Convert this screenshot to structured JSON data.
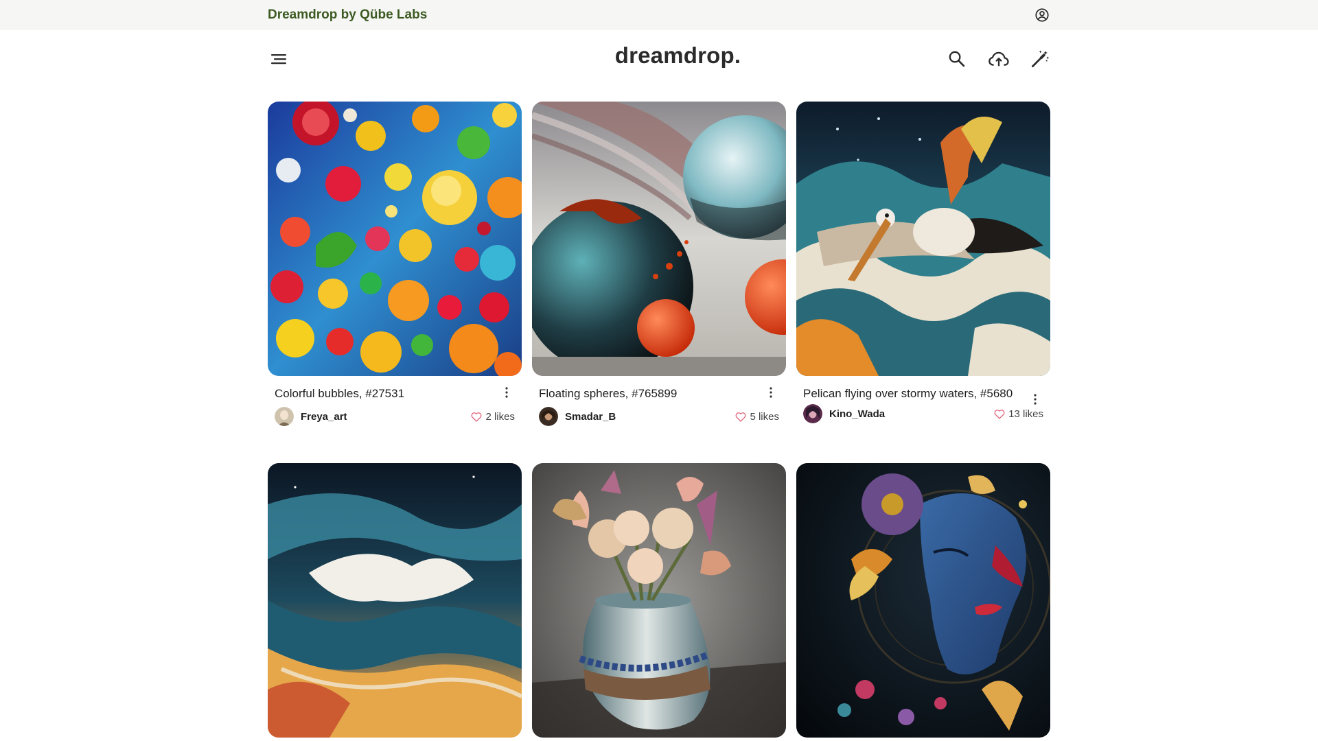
{
  "brandbar": {
    "title": "Dreamdrop by Qübe Labs",
    "account_icon": "account-circle-icon"
  },
  "header": {
    "logo": "dreamdrop.",
    "menu_icon": "menu-icon",
    "search_icon": "search-icon",
    "upload_icon": "cloud-upload-icon",
    "create_icon": "magic-wand-icon"
  },
  "colors": {
    "brand_text": "#3c5a21",
    "brandbar_bg": "#f6f6f5",
    "heart": "#e0637a"
  },
  "cards": [
    {
      "title": "Colorful bubbles, #27531",
      "author": "Freya_art",
      "likes": "2 likes"
    },
    {
      "title": "Floating spheres, #765899",
      "author": "Smadar_B",
      "likes": "5 likes"
    },
    {
      "title": "Pelican flying over stormy waters, #5680",
      "author": "Kino_Wada",
      "likes": "13 likes"
    },
    {
      "title": "",
      "author": "",
      "likes": ""
    },
    {
      "title": "",
      "author": "",
      "likes": ""
    },
    {
      "title": "",
      "author": "",
      "likes": ""
    }
  ]
}
